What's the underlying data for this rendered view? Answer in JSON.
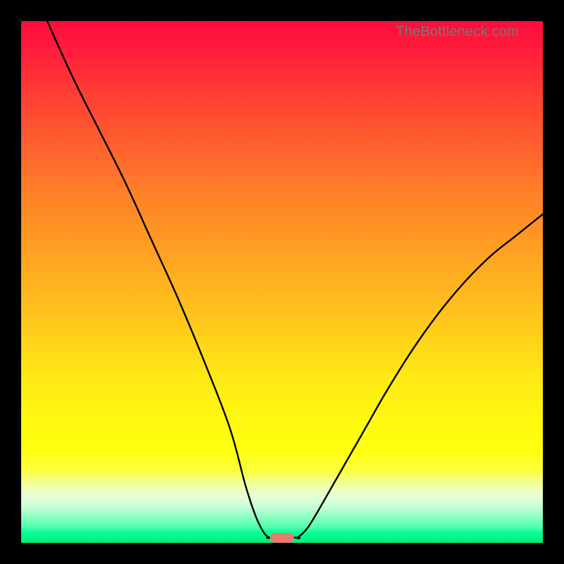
{
  "watermark": "TheBottleneck.com",
  "chart_data": {
    "type": "line",
    "title": "",
    "xlabel": "",
    "ylabel": "",
    "xlim": [
      0,
      100
    ],
    "ylim": [
      0,
      100
    ],
    "grid": false,
    "legend": false,
    "series": [
      {
        "name": "left-curve",
        "x": [
          5,
          10,
          15,
          20,
          25,
          30,
          35,
          40,
          43,
          45,
          46.5,
          47.5
        ],
        "y": [
          100,
          89,
          79,
          69,
          58,
          47,
          35,
          22,
          11,
          5,
          2,
          1
        ]
      },
      {
        "name": "flat-bottom",
        "x": [
          47.5,
          53
        ],
        "y": [
          1,
          1
        ]
      },
      {
        "name": "right-curve",
        "x": [
          53,
          55,
          58,
          62,
          66,
          70,
          75,
          80,
          85,
          90,
          95,
          100
        ],
        "y": [
          1,
          3,
          8,
          15,
          22,
          29,
          37,
          44,
          50,
          55,
          59,
          63
        ]
      }
    ],
    "marker": {
      "x": 50,
      "y": 1,
      "color": "#e97a6e"
    },
    "gradient_stops": [
      {
        "pct": 0,
        "color": "#ff0b3c"
      },
      {
        "pct": 25,
        "color": "#ff682d"
      },
      {
        "pct": 55,
        "color": "#ffc31c"
      },
      {
        "pct": 80,
        "color": "#ffff0d"
      },
      {
        "pct": 100,
        "color": "#00ee7a"
      }
    ]
  }
}
